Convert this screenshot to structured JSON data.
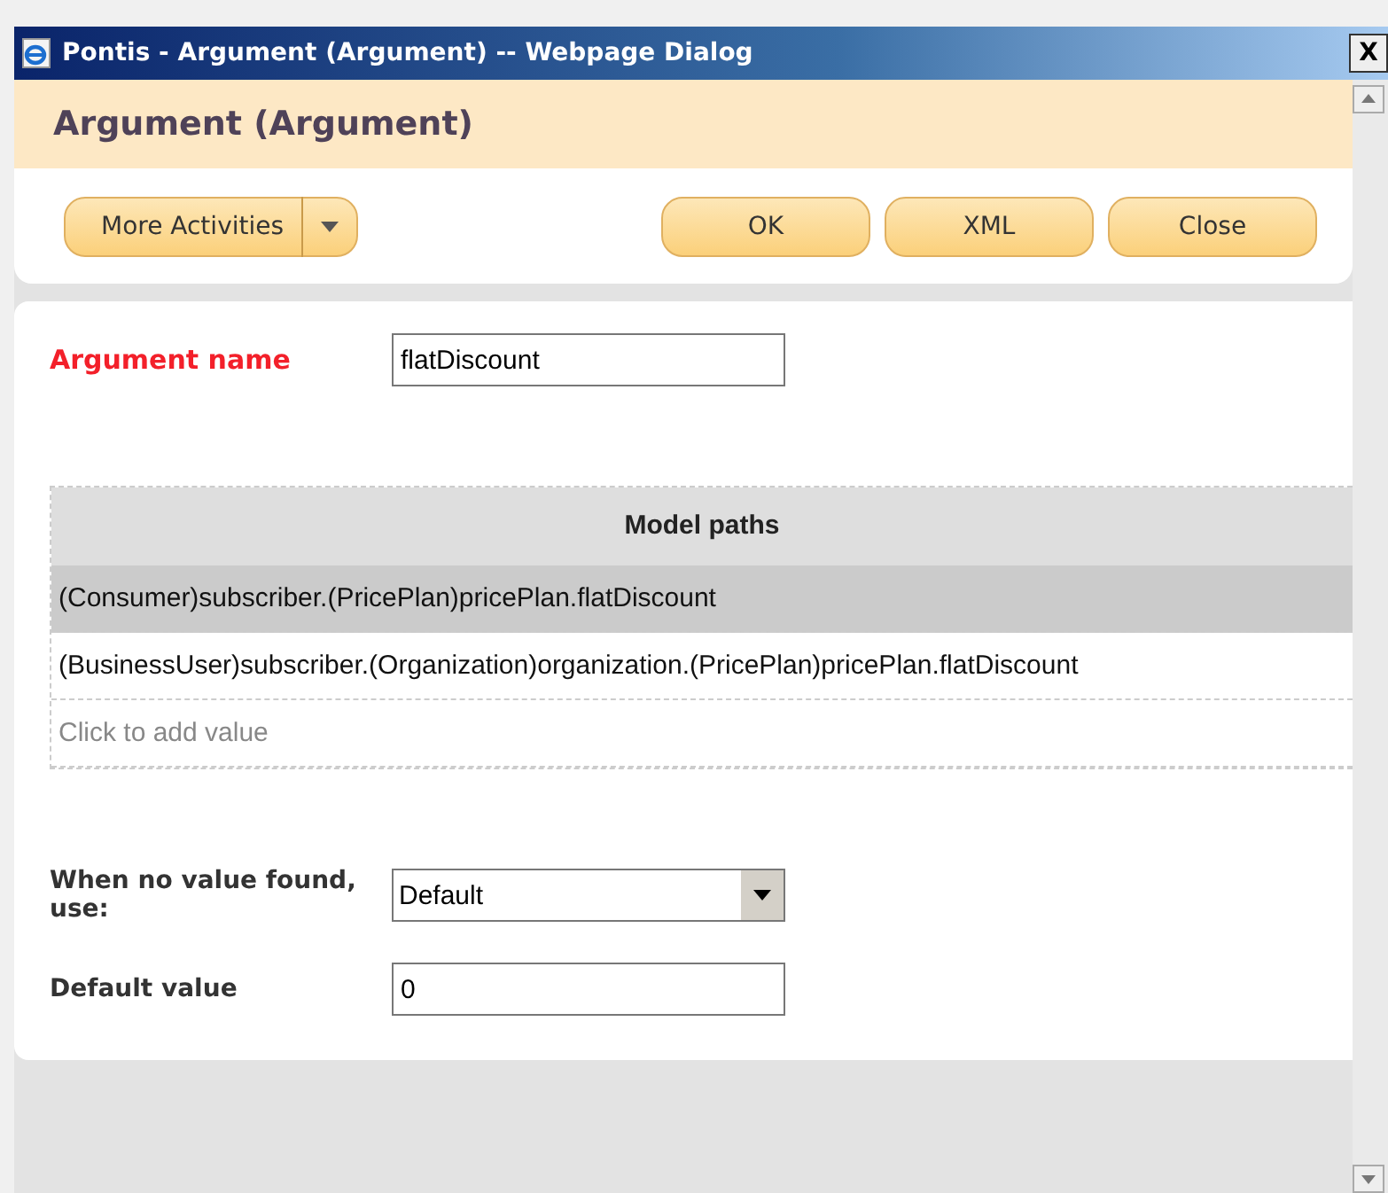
{
  "window": {
    "title": "Pontis - Argument (Argument) -- Webpage Dialog",
    "close": "X"
  },
  "header": {
    "title": "Argument (Argument)"
  },
  "toolbar": {
    "menu_button": "More Activities",
    "buttons": [
      "OK",
      "XML",
      "Close"
    ]
  },
  "form": {
    "name_label": "Argument name",
    "name_value": "flatDiscount"
  },
  "table": {
    "columns": [
      "Model paths"
    ],
    "rows": [
      {
        "value": "(Consumer)subscriber.(PricePlan)pricePlan.flatDiscount",
        "selected": true
      },
      {
        "value": "(BusinessUser)subscriber.(Organization)organization.(PricePlan)pricePlan.flatDiscount",
        "selected": false
      }
    ],
    "add_placeholder": "Click to add value"
  },
  "fallback": {
    "label": "When no value found, use:",
    "value": "Default"
  },
  "default": {
    "label": "Default value",
    "value": "0"
  }
}
